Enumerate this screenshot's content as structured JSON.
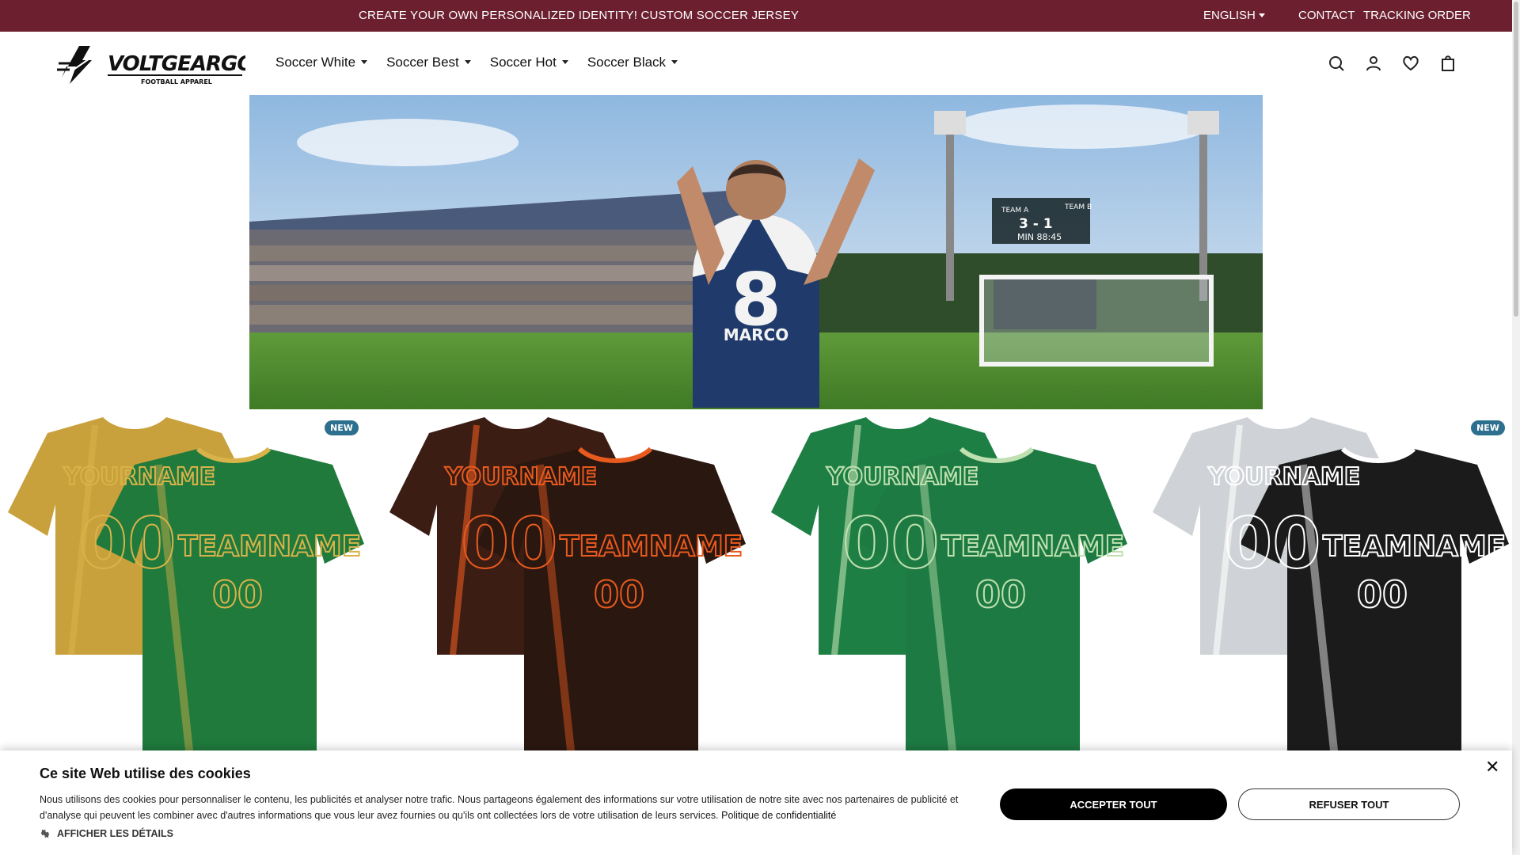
{
  "announcement": {
    "text": "CREATE YOUR OWN PERSONALIZED IDENTITY! CUSTOM SOCCER JERSEY",
    "language": "ENGLISH",
    "contact": "CONTACT",
    "tracking": "TRACKING ORDER"
  },
  "brand": {
    "name": "VOLTGEARGO",
    "tagline": "FOOTBALL APPAREL"
  },
  "nav": [
    "Soccer White",
    "Soccer Best",
    "Soccer Hot",
    "Soccer Black"
  ],
  "header_icons": [
    "search-icon",
    "account-icon",
    "wishlist-icon",
    "cart-icon"
  ],
  "hero": {
    "scoreboard": {
      "team_a": "TEAM A",
      "team_b": "TEAM B",
      "score": "3 - 1",
      "time": "MIN 88:45"
    },
    "player": {
      "number": "8",
      "name": "MARCO"
    }
  },
  "products": [
    {
      "badge": "NEW",
      "back_text": "YOURNAME",
      "front_text": "TEAMNAME",
      "number": "00",
      "colors": {
        "back": "#c9a13c",
        "front": "#1f7a3c",
        "accent": "#d9b24a"
      }
    },
    {
      "badge": "",
      "back_text": "YOURNAME",
      "front_text": "TEAMNAME",
      "number": "00",
      "colors": {
        "back": "#3b1d14",
        "front": "#2a1710",
        "accent": "#e85a1e"
      }
    },
    {
      "badge": "",
      "back_text": "YOURNAME",
      "front_text": "TEAMNAME",
      "number": "00",
      "colors": {
        "back": "#1e7f45",
        "front": "#1d7a42",
        "accent": "#bfe0b0"
      }
    },
    {
      "badge": "NEW",
      "back_text": "YOURNAME",
      "front_text": "TEAMNAME",
      "number": "00",
      "colors": {
        "back": "#cfd2d6",
        "front": "#1b1b1b",
        "accent": "#ffffff"
      }
    }
  ],
  "cookie": {
    "title": "Ce site Web utilise des cookies",
    "description": "Nous utilisons des cookies pour personnaliser le contenu, les publicités et analyser notre trafic. Nous partageons également des informations sur votre utilisation de notre site avec nos partenaires de publicité et d'analyse qui peuvent les combiner avec d'autres informations que vous leur avez fournies ou qu'ils ont collectées lors de votre utilisation de leurs services.",
    "policy_link": "Politique de confidentialité",
    "details": "AFFICHER LES DÉTAILS",
    "accept": "ACCEPTER TOUT",
    "refuse": "REFUSER TOUT",
    "close": "✕"
  },
  "theme": {
    "topbar": "#6b1f2f",
    "badge": "#2c6f8e"
  }
}
